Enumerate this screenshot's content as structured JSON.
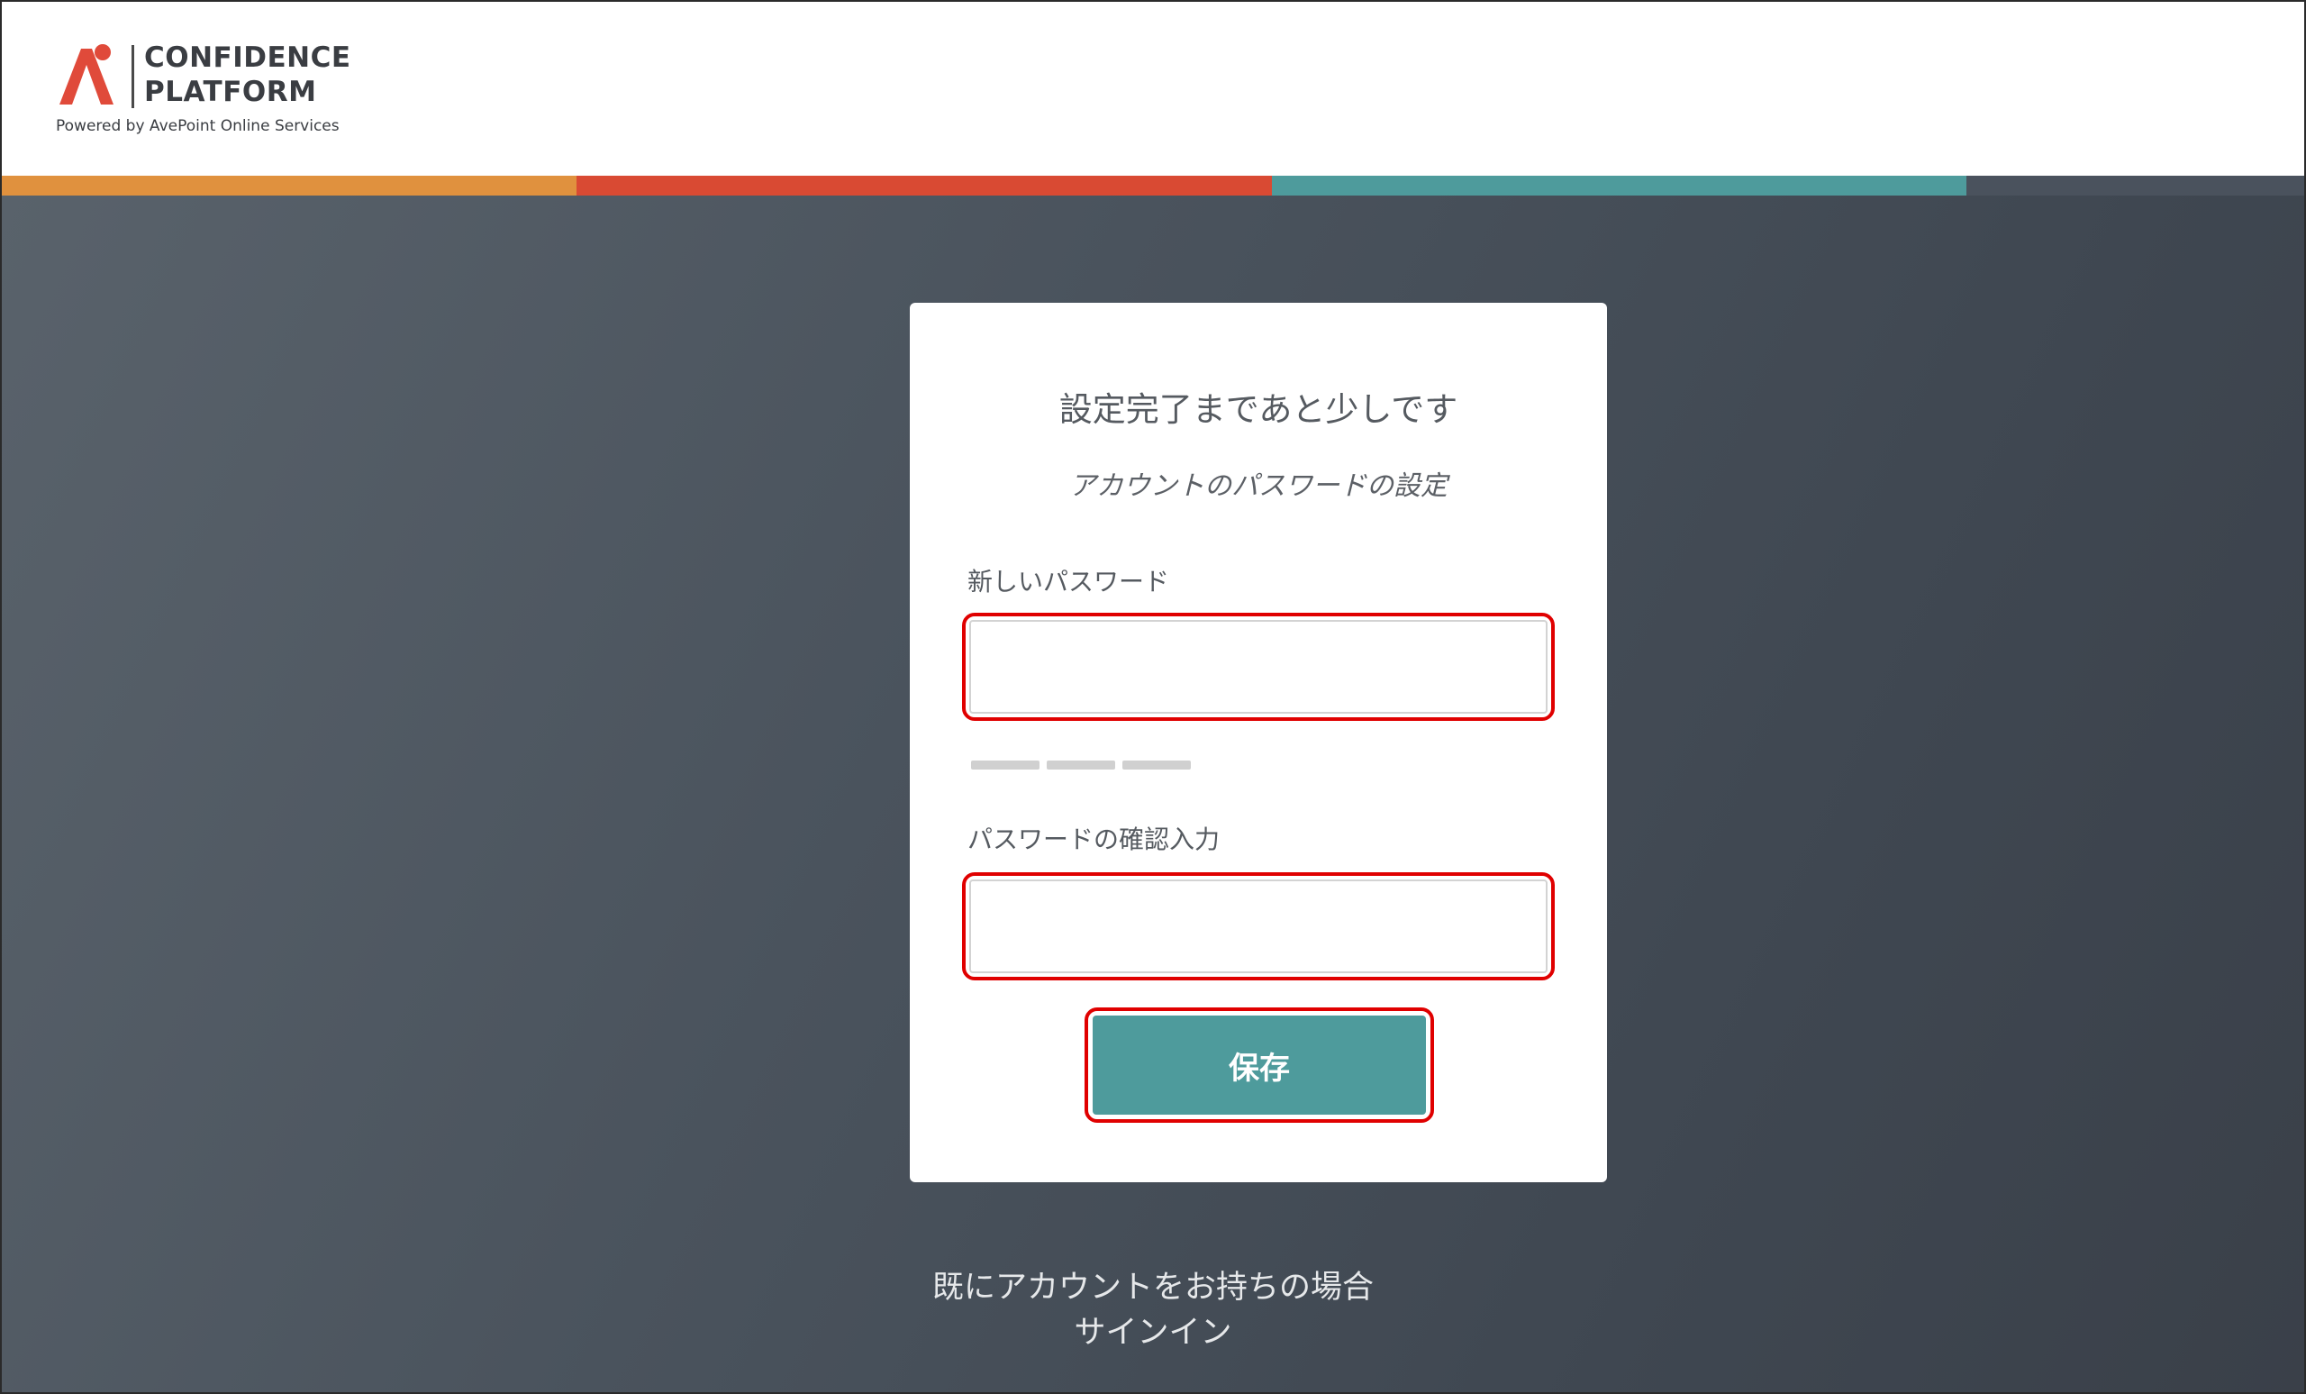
{
  "brand": {
    "line1": "CONFIDENCE",
    "line2": "PLATFORM",
    "powered_by": "Powered by AvePoint Online Services",
    "accent_colors": [
      "#e0913e",
      "#d94a33",
      "#4e9b9c",
      "#4a525d"
    ]
  },
  "card": {
    "title": "設定完了まであと少しです",
    "subtitle": "アカウントのパスワードの設定",
    "new_password_label": "新しいパスワード",
    "new_password_value": "",
    "confirm_password_label": "パスワードの確認入力",
    "confirm_password_value": "",
    "save_label": "保存",
    "button_color": "#4e9b9c",
    "highlight_color": "#e00000"
  },
  "footer": {
    "existing_account_text": "既にアカウントをお持ちの場合",
    "signin_label": "サインイン"
  }
}
